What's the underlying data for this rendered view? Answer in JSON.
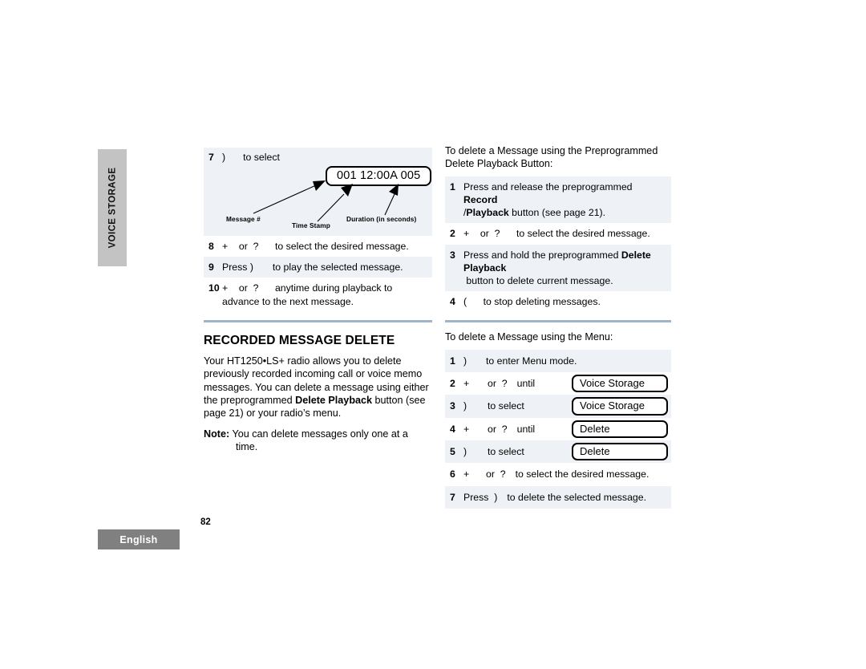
{
  "side_tab": {
    "label": "VOICE STORAGE"
  },
  "footer": {
    "language": "English",
    "page_number": "82"
  },
  "colors": {
    "row_shade": "#eef2f6",
    "divider": "#9fb4c7",
    "side_tab_bg": "#c3c3c3",
    "lang_tab_bg": "#808080"
  },
  "left_column": {
    "illustration_step": {
      "num": "7",
      "key_glyph": ")",
      "text": "to select",
      "display_value": "001 12:00A 005",
      "annotations": {
        "message": "Message #",
        "time": "Time Stamp",
        "duration": "Duration (in seconds)"
      }
    },
    "steps": [
      {
        "num": "8",
        "parts": [
          {
            "t": "+",
            "b": false
          },
          {
            "t": "    or  ",
            "b": false
          },
          {
            "t": "?",
            "b": false
          },
          {
            "t": "      to select the desired message.",
            "b": false
          }
        ]
      },
      {
        "num": "9",
        "parts": [
          {
            "t": "Press ",
            "b": false
          },
          {
            "t": ")",
            "b": false
          },
          {
            "t": "       to play the selected message.",
            "b": false
          }
        ]
      },
      {
        "num": "10",
        "parts": [
          {
            "t": "+",
            "b": false
          },
          {
            "t": "    or  ",
            "b": false
          },
          {
            "t": "?",
            "b": false
          },
          {
            "t": "      anytime during playback to",
            "b": false
          },
          {
            "t": "advance to the next message.",
            "b": false,
            "wrap": true
          }
        ]
      }
    ],
    "section": {
      "heading": "RECORDED MESSAGE DELETE",
      "paragraph_parts": [
        {
          "t": "Your HT1250•LS+ radio allows you to delete previously recorded incoming call or voice memo messages. You can delete a message using either the preprogrammed ",
          "b": false
        },
        {
          "t": "Delete Playback",
          "b": true
        },
        {
          "t": " button (see page 21) or your radio’s menu.",
          "b": false
        }
      ],
      "note_label": "Note:",
      "note_text": " You can delete messages only one at a time."
    }
  },
  "right_column": {
    "intro1": "To delete a Message using the Preprogrammed Delete Playback Button:",
    "button_steps": [
      {
        "num": "1",
        "parts": [
          {
            "t": "Press and release the preprogrammed",
            "b": false
          },
          {
            "t": "Record",
            "b": true,
            "wrap": true
          },
          {
            "t": "/",
            "b": false
          },
          {
            "t": "Playback",
            "b": true
          },
          {
            "t": " button (see page 21).",
            "b": false
          }
        ]
      },
      {
        "num": "2",
        "parts": [
          {
            "t": "+",
            "b": false
          },
          {
            "t": "    or  ",
            "b": false
          },
          {
            "t": "?",
            "b": false
          },
          {
            "t": "      to select the desired message.",
            "b": false
          }
        ]
      },
      {
        "num": "3",
        "parts": [
          {
            "t": "Press and hold the preprogrammed ",
            "b": false
          },
          {
            "t": "Delete",
            "b": true
          },
          {
            "t": "Playback",
            "b": true,
            "wrap": true
          },
          {
            "t": " button to delete current message.",
            "b": false
          }
        ]
      },
      {
        "num": "4",
        "parts": [
          {
            "t": "(",
            "b": false
          },
          {
            "t": "      to stop deleting messages.",
            "b": false
          }
        ]
      }
    ],
    "intro2": "To delete a Message using the Menu:",
    "menu_steps": [
      {
        "num": "1",
        "glyph": ")",
        "mid": "to enter Menu mode.",
        "tail": "",
        "lcd": null
      },
      {
        "num": "2",
        "glyph": "+",
        "mid": "or  ?",
        "tail": "until",
        "lcd": "Voice Storage"
      },
      {
        "num": "3",
        "glyph": ")",
        "mid": "to select",
        "tail": "",
        "lcd": "Voice Storage"
      },
      {
        "num": "4",
        "glyph": "+",
        "mid": "or  ?",
        "tail": "until",
        "lcd": "Delete"
      },
      {
        "num": "5",
        "glyph": ")",
        "mid": "to select",
        "tail": "",
        "lcd": "Delete"
      },
      {
        "num": "6",
        "glyph": "+",
        "mid": "or  ?",
        "tail": "to select the desired message.",
        "lcd": null
      },
      {
        "num": "7",
        "glyph": "Press  )",
        "mid": "to delete the selected message.",
        "tail": "",
        "lcd": null
      }
    ]
  }
}
